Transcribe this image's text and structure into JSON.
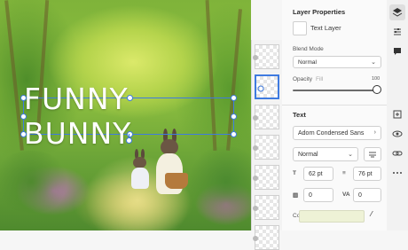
{
  "canvas": {
    "text_layer_content": "FUNNY BUNNY"
  },
  "properties": {
    "title": "Layer Properties",
    "layer_name": "Text Layer",
    "blend_mode_label": "Blend Mode",
    "blend_mode_value": "Normal",
    "opacity_label": "Opacity",
    "opacity_field": "Fill",
    "opacity_value": "100",
    "opacity_fraction": 1.0
  },
  "text_section": {
    "title": "Text",
    "font_family": "Adorn Condensed Sans",
    "font_style": "Normal",
    "font_size": "62 pt",
    "line_height": "76 pt",
    "tracking": "0",
    "kerning": "0",
    "color_label": "Color",
    "color_value": "#eef2d6"
  },
  "rail": {
    "icons": [
      "layers-icon",
      "adjustments-icon",
      "comments-icon",
      "add-layer-icon",
      "visibility-icon",
      "link-icon",
      "more-icon"
    ]
  },
  "colors": {
    "accent": "#3f7be0",
    "panel_bg": "#fafafa"
  }
}
